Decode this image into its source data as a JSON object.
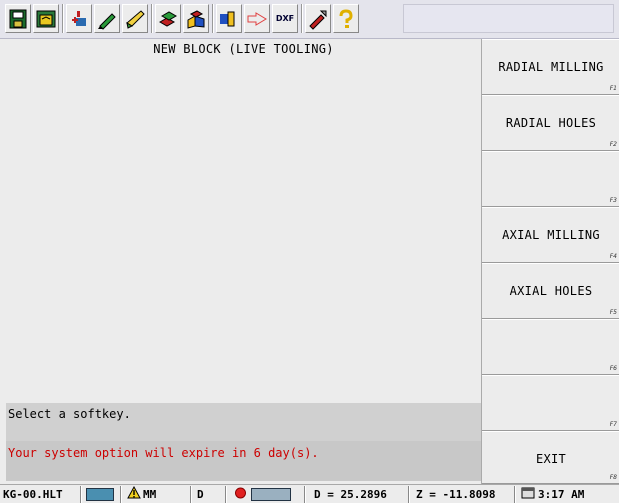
{
  "toolbar": {
    "buttons": [
      {
        "name": "file-save-icon",
        "group": 1
      },
      {
        "name": "open-folder-icon",
        "group": 1
      },
      {
        "name": "axis-setup-icon",
        "group": 2
      },
      {
        "name": "edit-pencil-icon",
        "group": 2
      },
      {
        "name": "paint-brush-icon",
        "group": 2
      },
      {
        "name": "solid-blocks-icon",
        "group": 3
      },
      {
        "name": "shapes-3d-icon",
        "group": 3
      },
      {
        "name": "part-profile-icon",
        "group": 4
      },
      {
        "name": "wire-outline-icon",
        "group": 4
      },
      {
        "name": "dxf-import-icon",
        "group": 4,
        "text": "DXF"
      },
      {
        "name": "tools-wrench-icon",
        "group": 5
      },
      {
        "name": "help-question-icon",
        "group": 5
      }
    ]
  },
  "page": {
    "title": "NEW BLOCK (LIVE TOOLING)",
    "prompt": "Select a softkey.",
    "warning": "Your system option will expire in 6 day(s)."
  },
  "softkeys": [
    {
      "label": "RADIAL MILLING",
      "fkey": "F1"
    },
    {
      "label": "RADIAL HOLES",
      "fkey": "F2"
    },
    {
      "label": "",
      "fkey": "F3"
    },
    {
      "label": "AXIAL MILLING",
      "fkey": "F4"
    },
    {
      "label": "AXIAL HOLES",
      "fkey": "F5"
    },
    {
      "label": "",
      "fkey": "F6"
    },
    {
      "label": "",
      "fkey": "F7"
    },
    {
      "label": "EXIT",
      "fkey": "F8"
    }
  ],
  "status": {
    "filename": "KG-00.HLT",
    "units": "MM",
    "mode": "D",
    "d_readout": "D = 25.2896",
    "z_readout": "Z = -11.8098",
    "time": "3:17 AM"
  },
  "colors": {
    "warning_text": "#cc0000",
    "background": "#ececec",
    "message_bar": "#d0d0d0"
  }
}
